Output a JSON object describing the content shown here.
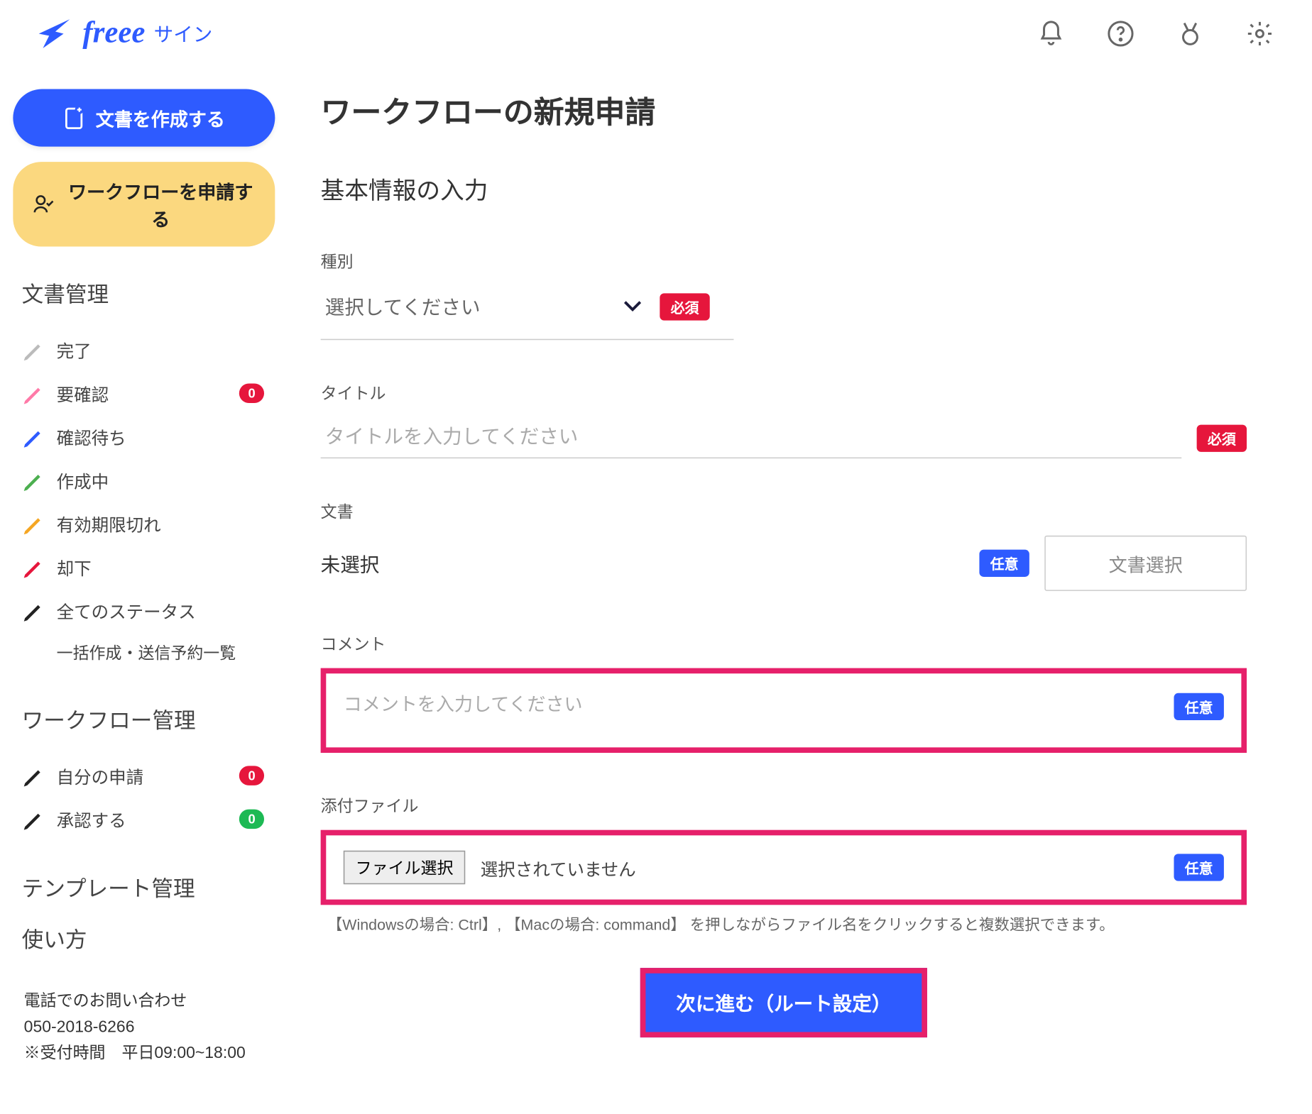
{
  "logo": {
    "text": "freee",
    "sub": "サイン"
  },
  "sidebar": {
    "create_doc": "文書を作成する",
    "apply_workflow": "ワークフローを申請する",
    "doc_mgmt": "文書管理",
    "items": [
      {
        "label": "完了"
      },
      {
        "label": "要確認",
        "badge": "0",
        "badge_class": "red"
      },
      {
        "label": "確認待ち"
      },
      {
        "label": "作成中"
      },
      {
        "label": "有効期限切れ"
      },
      {
        "label": "却下"
      },
      {
        "label": "全てのステータス"
      }
    ],
    "bulk": "一括作成・送信予約一覧",
    "wf_mgmt": "ワークフロー管理",
    "wf_items": [
      {
        "label": "自分の申請",
        "badge": "0",
        "badge_class": "red"
      },
      {
        "label": "承認する",
        "badge": "0",
        "badge_class": "green"
      }
    ],
    "tpl_mgmt": "テンプレート管理",
    "howto": "使い方",
    "contact": {
      "line1": "電話でのお問い合わせ",
      "phone": "050-2018-6266",
      "hours": "※受付時間　平日09:00~18:00"
    }
  },
  "main": {
    "title": "ワークフローの新規申請",
    "section": "基本情報の入力",
    "type": {
      "label": "種別",
      "placeholder": "選択してください",
      "required": "必須"
    },
    "title_field": {
      "label": "タイトル",
      "placeholder": "タイトルを入力してください",
      "required": "必須"
    },
    "doc": {
      "label": "文書",
      "status": "未選択",
      "optional": "任意",
      "button": "文書選択"
    },
    "comment": {
      "label": "コメント",
      "placeholder": "コメントを入力してください",
      "optional": "任意"
    },
    "attach": {
      "label": "添付ファイル",
      "button": "ファイル選択",
      "status": "選択されていません",
      "optional": "任意",
      "hint": "【Windowsの場合: Ctrl】, 【Macの場合: command】 を押しながらファイル名をクリックすると複数選択できます。"
    },
    "next": "次に進む（ルート設定）"
  }
}
